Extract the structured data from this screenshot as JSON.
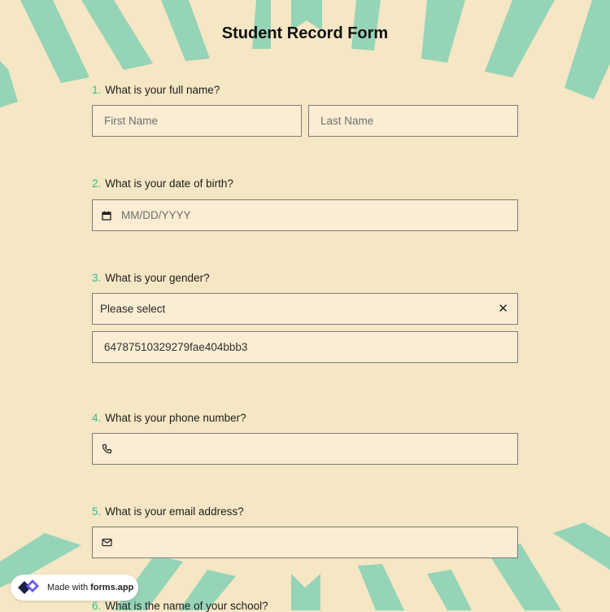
{
  "form": {
    "title": "Student Record Form",
    "questions": [
      {
        "number": "1.",
        "label": "What is your full name?",
        "fields": [
          {
            "placeholder": "First Name"
          },
          {
            "placeholder": "Last Name"
          }
        ]
      },
      {
        "number": "2.",
        "label": "What is your date of birth?",
        "field": {
          "placeholder": "MM/DD/YYYY",
          "icon": "calendar-icon"
        }
      },
      {
        "number": "3.",
        "label": "What is your gender?",
        "select": {
          "value": "Please select",
          "clear_icon": "close-icon"
        },
        "extra_value": "64787510329279fae404bbb3"
      },
      {
        "number": "4.",
        "label": "What is your phone number?",
        "field": {
          "placeholder": "",
          "icon": "phone-icon"
        }
      },
      {
        "number": "5.",
        "label": "What is your email address?",
        "field": {
          "placeholder": "",
          "icon": "mail-icon"
        }
      },
      {
        "number": "6.",
        "label": "What is the name of your school?"
      }
    ]
  },
  "badge": {
    "prefix": "Made with",
    "brand": "forms.app",
    "icon": "forms-app-logo-icon"
  },
  "colors": {
    "background": "#f5e6c4",
    "accent_stripes": "#8fd4b5",
    "number_color": "#2fbf8e",
    "field_background": "#faedd3",
    "field_border": "#7c7c7c"
  }
}
